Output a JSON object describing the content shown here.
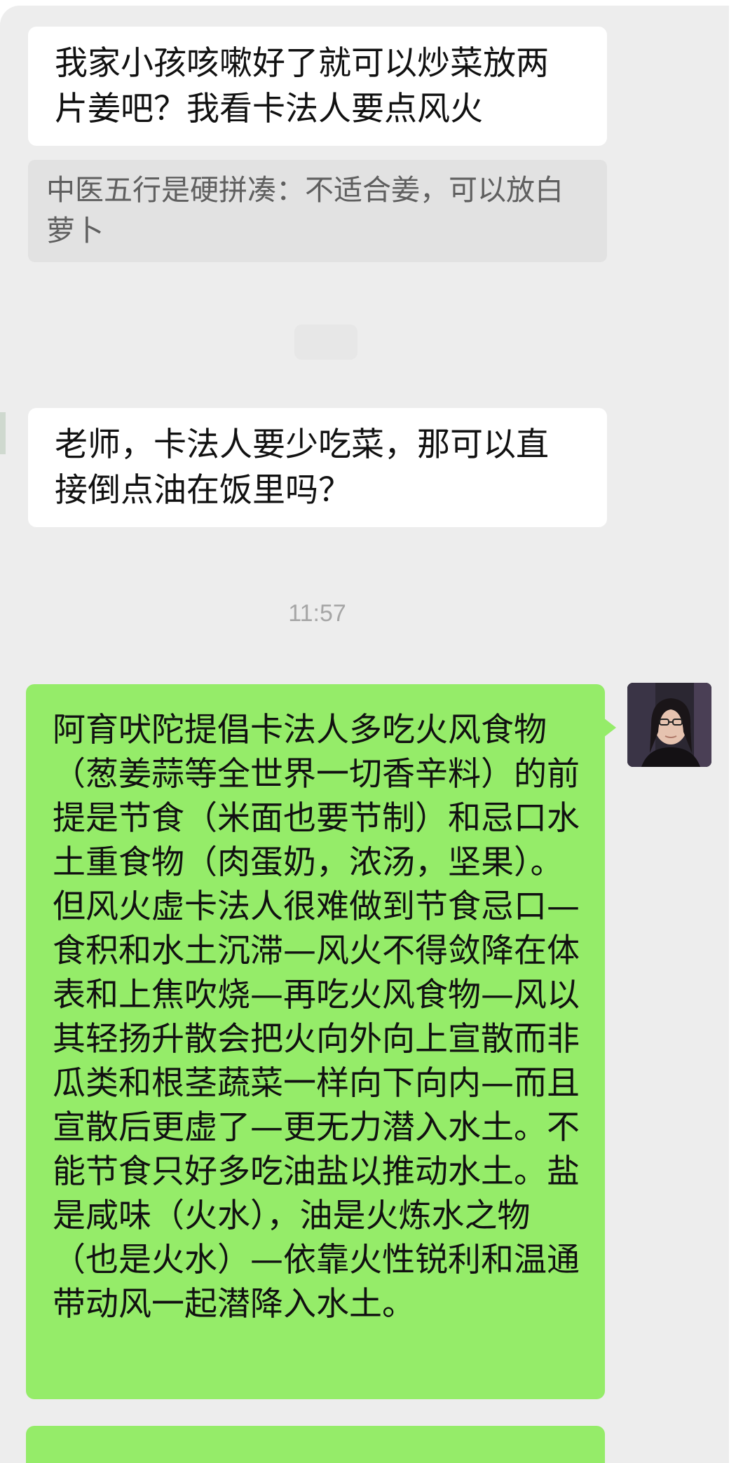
{
  "messages": [
    {
      "text": "我家小孩咳嗽好了就可以炒菜放两片姜吧？我看卡法人要点风火",
      "quote": "中医五行是硬拼凑：不适合姜，可以放白萝卜"
    },
    {
      "text": "老师，卡法人要少吃菜，那可以直接倒点油在饭里吗？"
    }
  ],
  "timestamp": "11:57",
  "reply": {
    "text": "阿育吠陀提倡卡法人多吃火风食物（葱姜蒜等全世界一切香辛料）的前提是节食（米面也要节制）和忌口水土重食物（肉蛋奶，浓汤，坚果）。但风火虚卡法人很难做到节食忌口—食积和水土沉滞—风火不得敛降在体表和上焦吹烧—再吃火风食物—风以其轻扬升散会把火向外向上宣散而非瓜类和根茎蔬菜一样向下向内—而且宣散后更虚了—更无力潜入水土。不能节食只好多吃油盐以推动水土。盐是咸味（火水），油是火炼水之物（也是火水）—依靠火性锐利和温通带动风一起潜降入水土。"
  },
  "colors": {
    "chat_bg": "#ededed",
    "incoming_bubble": "#ffffff",
    "outgoing_bubble": "#95ec69",
    "quote_bg": "#e2e2e2"
  }
}
